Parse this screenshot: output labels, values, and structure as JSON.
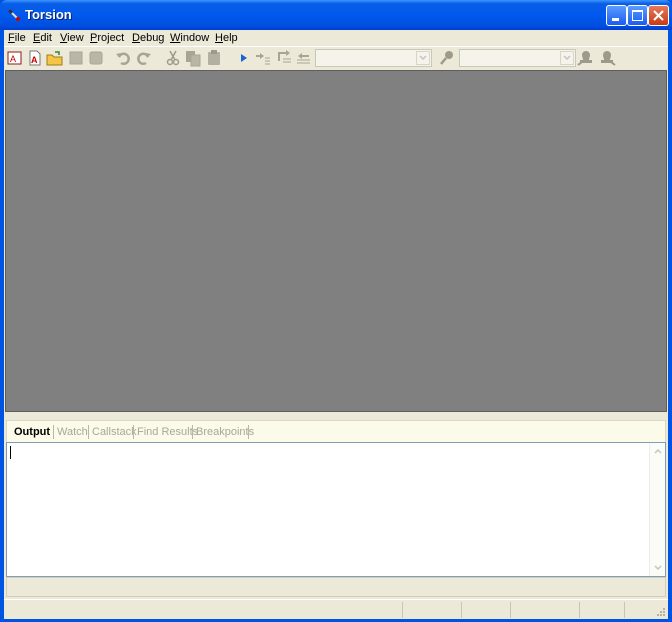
{
  "window": {
    "title": "Torsion"
  },
  "menu": [
    {
      "accel": "F",
      "rest": "ile"
    },
    {
      "accel": "E",
      "rest": "dit"
    },
    {
      "accel": "V",
      "rest": "iew"
    },
    {
      "accel": "P",
      "rest": "roject"
    },
    {
      "accel": "D",
      "rest": "ebug"
    },
    {
      "accel": "W",
      "rest": "indow"
    },
    {
      "accel": "H",
      "rest": "elp"
    }
  ],
  "toolbar": {
    "icons": [
      "new-project-icon",
      "new-file-icon",
      "open-icon",
      "save-icon",
      "save-all-icon",
      "undo-icon",
      "redo-icon",
      "cut-icon",
      "copy-icon",
      "paste-icon",
      "run-icon",
      "step-into-icon",
      "step-over-icon",
      "step-out-icon",
      "find-icon",
      "bookmark-prev-icon",
      "bookmark-next-icon"
    ],
    "config_combo_value": "",
    "find_combo_value": ""
  },
  "tabs": [
    "Output",
    "Watch",
    "Callstack",
    "Find Results",
    "Breakpoints"
  ],
  "active_tab": "Output",
  "output": {
    "text": ""
  },
  "colors": {
    "titlebar": "#0058ee",
    "mdi_background": "#808080",
    "chrome": "#ece9d8"
  }
}
